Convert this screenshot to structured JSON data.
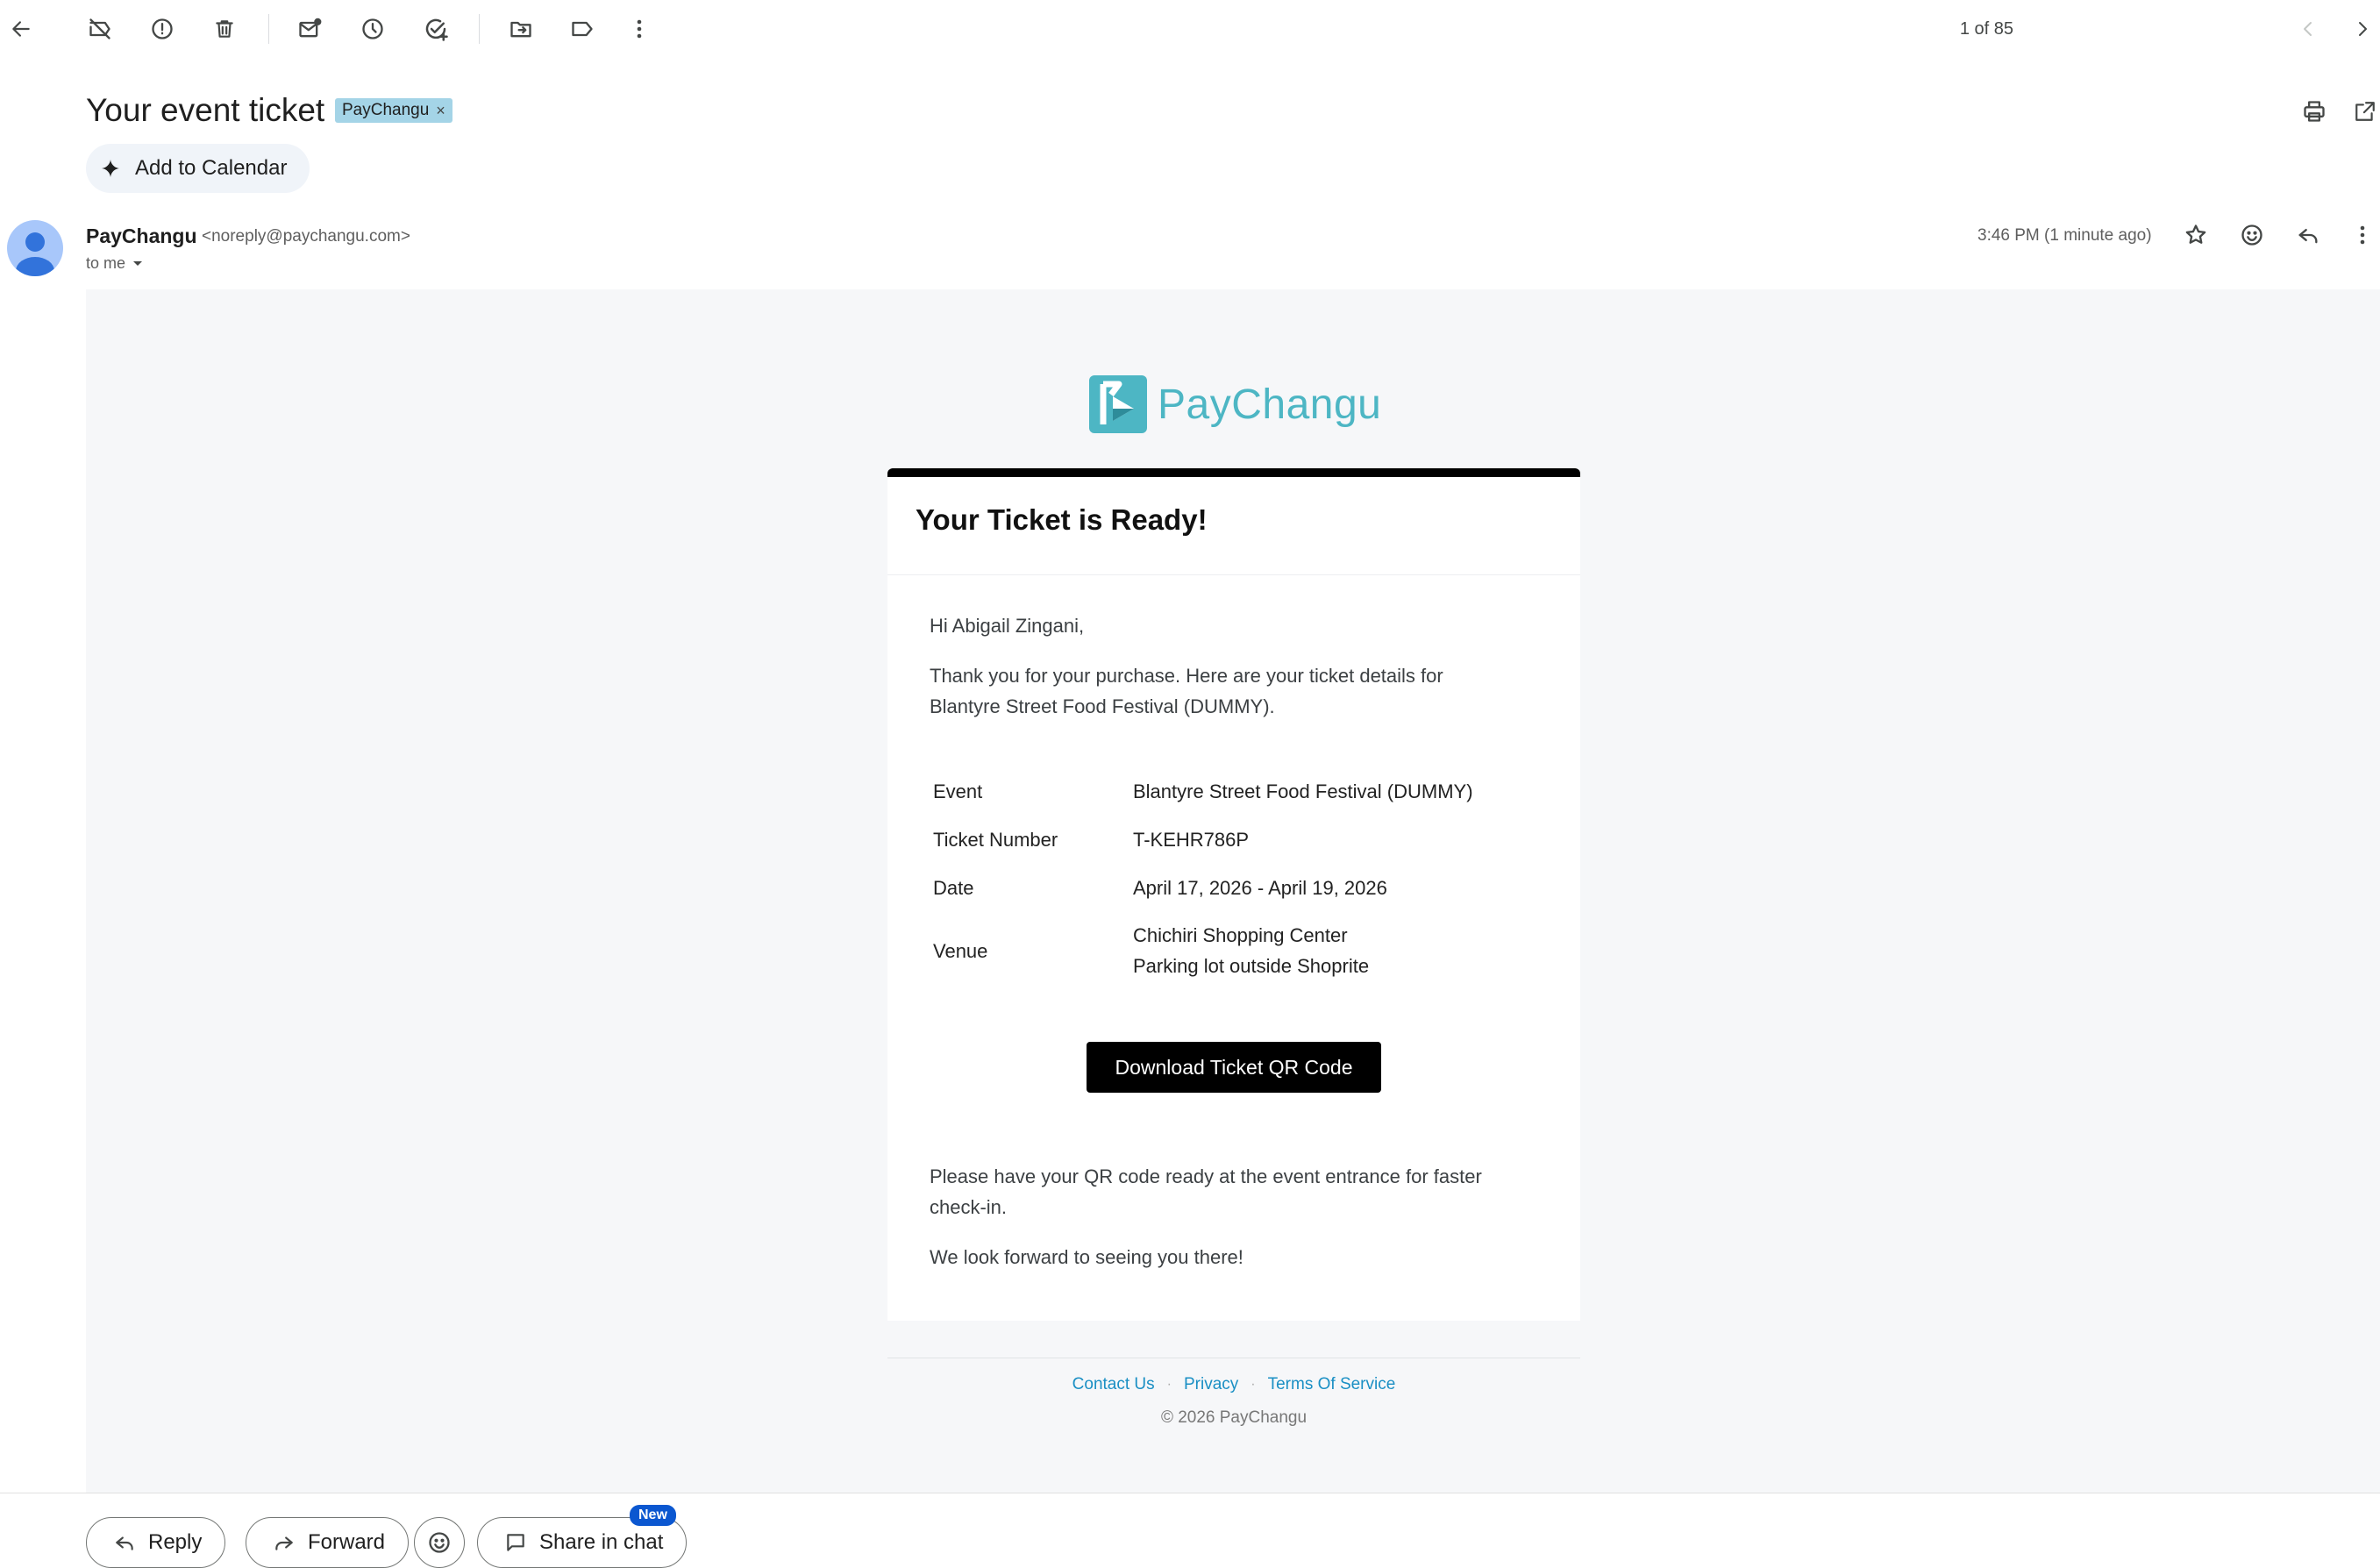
{
  "toolbar": {
    "pager_text": "1 of 85"
  },
  "header": {
    "subject": "Your event ticket",
    "label_chip": "PayChangu",
    "label_remove": "×",
    "add_to_calendar": "Add to Calendar"
  },
  "message": {
    "sender_name": "PayChangu",
    "sender_email": "<noreply@paychangu.com>",
    "recipient": "to me",
    "timestamp": "3:46 PM (1 minute ago)"
  },
  "email": {
    "brand_name": "PayChangu",
    "brand_color": "#4db6c4",
    "title": "Your Ticket is Ready!",
    "greeting": "Hi Abigail Zingani,",
    "intro_line1": "Thank you for your purchase. Here are your ticket details for",
    "intro_line2": "Blantyre Street Food Festival (DUMMY).",
    "details": [
      {
        "label": "Event",
        "value": "Blantyre Street Food Festival (DUMMY)"
      },
      {
        "label": "Ticket Number",
        "value": "T-KEHR786P"
      },
      {
        "label": "Date",
        "value": "April 17, 2026 - April 19, 2026"
      },
      {
        "label": "Venue",
        "value": "Chichiri Shopping Center",
        "value2": "Parking lot outside Shoprite"
      }
    ],
    "download_button": "Download Ticket QR Code",
    "closing_line1": "Please have your QR code ready at the event entrance for faster",
    "closing_line2": "check-in.",
    "closing_2": "We look forward to seeing you there!",
    "footer_links": [
      "Contact Us",
      "Privacy",
      "Terms Of Service"
    ],
    "footer_separator": "·",
    "copyright": "© 2026 PayChangu"
  },
  "actions": {
    "reply": "Reply",
    "forward": "Forward",
    "share_in_chat": "Share in chat",
    "new_badge": "New"
  },
  "icons": {
    "toolbar": [
      "back-arrow-icon",
      "report-spam-off-icon",
      "report-icon",
      "delete-icon",
      "mark-unread-icon",
      "snooze-icon",
      "add-task-icon",
      "move-to-icon",
      "label-icon",
      "more-vert-icon",
      "chevron-left-icon",
      "chevron-right-icon"
    ],
    "header_right": [
      "print-icon",
      "open-in-new-icon"
    ],
    "message": [
      "star-icon",
      "emoji-icon",
      "reply-icon",
      "more-vert-icon"
    ]
  }
}
